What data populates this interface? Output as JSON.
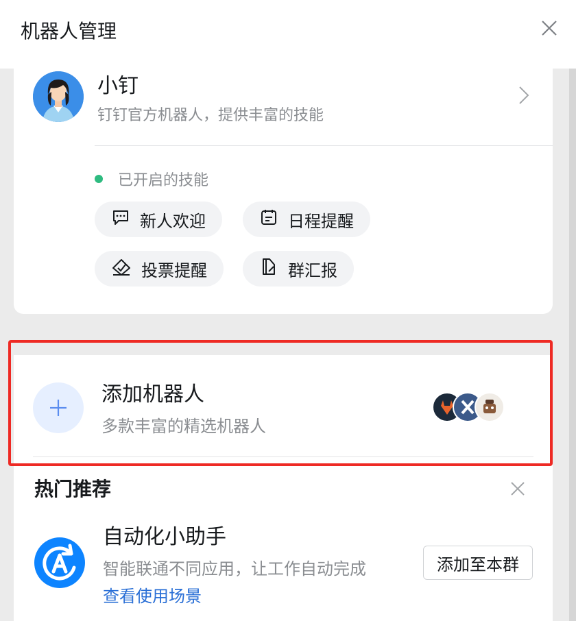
{
  "header": {
    "title": "机器人管理"
  },
  "bot": {
    "name": "小钉",
    "description": "钉钉官方机器人，提供丰富的技能",
    "skills_label": "已开启的技能",
    "skills": [
      {
        "label": "新人欢迎",
        "icon": "chat-bubble-icon"
      },
      {
        "label": "日程提醒",
        "icon": "calendar-icon"
      },
      {
        "label": "投票提醒",
        "icon": "vote-icon"
      },
      {
        "label": "群汇报",
        "icon": "report-icon"
      }
    ]
  },
  "add_robot": {
    "title": "添加机器人",
    "description": "多款丰富的精选机器人"
  },
  "hot": {
    "title": "热门推荐",
    "app": {
      "name": "自动化小助手",
      "description": "智能联通不同应用，让工作自动完成",
      "link": "查看使用场景",
      "button": "添加至本群"
    }
  },
  "colors": {
    "accent": "#0d84ff",
    "highlight": "#ee2a24",
    "skill_active": "#2ebb80",
    "link": "#2a6fd6"
  }
}
